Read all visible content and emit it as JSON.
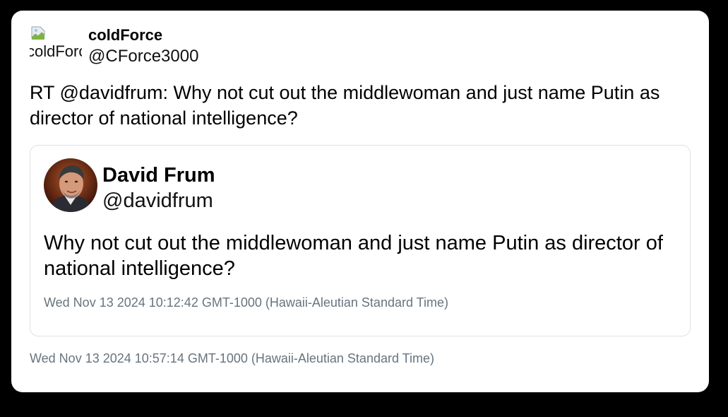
{
  "tweet": {
    "author": {
      "avatar_alt": "coldForce",
      "name": "coldForce",
      "handle": "@CForce3000"
    },
    "text": "RT @davidfrum: Why not cut out the middlewoman and just name Putin as director of national intelligence?",
    "timestamp": "Wed Nov 13 2024 10:57:14 GMT-1000 (Hawaii-Aleutian Standard Time)",
    "quoted": {
      "name": "David Frum",
      "handle": "@davidfrum",
      "text": "Why not cut out the middlewoman and just name Putin as director of national intelligence?",
      "timestamp": "Wed Nov 13 2024 10:12:42 GMT-1000 (Hawaii-Aleutian Standard Time)"
    }
  },
  "colors": {
    "page_background": "#000000",
    "card_background": "#ffffff",
    "border": "#dde2e6",
    "timestamp": "#66747f"
  },
  "icons": {
    "broken_avatar": "broken-image-icon",
    "quote_avatar": "profile-photo"
  }
}
